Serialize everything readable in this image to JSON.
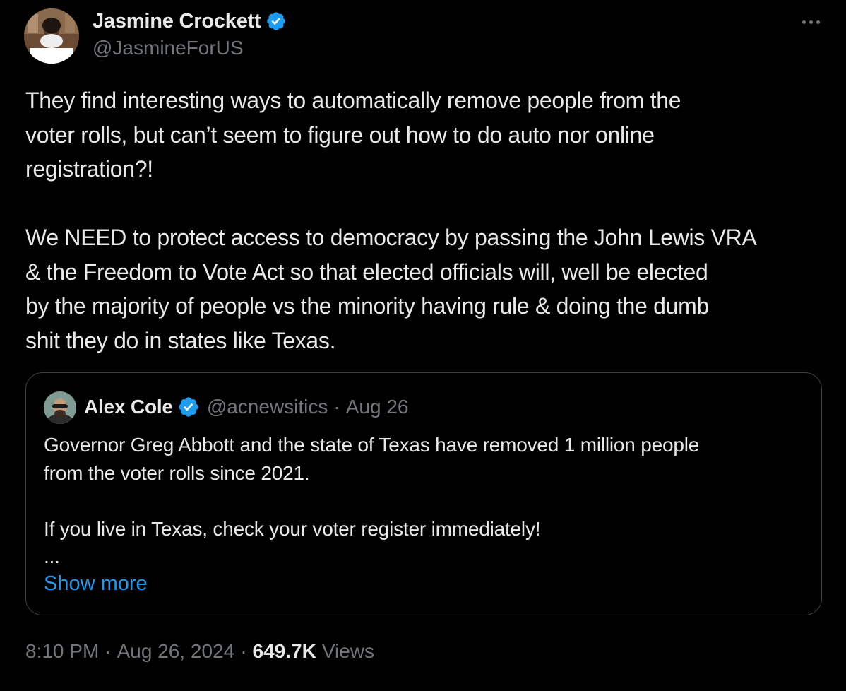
{
  "author": {
    "name": "Jasmine Crockett",
    "handle": "@JasmineForUS",
    "verified": true
  },
  "tweet": {
    "text": "They find interesting ways to automatically remove people from the\nvoter rolls, but can’t seem to figure out how to do auto nor online\nregistration?!\n\nWe NEED to protect access to democracy by passing the John Lewis VRA\n& the Freedom to Vote Act so that elected officials will, well be elected\nby the majority of people vs the minority having rule & doing the dumb\nshit they do in states like Texas."
  },
  "quote": {
    "name": "Alex Cole",
    "handle": "@acnewsitics",
    "separator": "·",
    "date": "Aug 26",
    "text": "Governor Greg Abbott and the state of Texas have removed 1 million people\nfrom the voter rolls since 2021.\n\nIf you live in Texas, check your voter register immediately!\n...",
    "show_more_label": "Show more"
  },
  "meta": {
    "time": "8:10 PM",
    "separator": "·",
    "date": "Aug 26, 2024",
    "views_count": "649.7K",
    "views_label": "Views"
  },
  "icons": {
    "verified": "verified-badge-icon",
    "more": "more-horizontal-icon"
  },
  "colors": {
    "background": "#000000",
    "text_primary": "#e7e9ea",
    "text_secondary": "#71767b",
    "accent": "#1d9bf0",
    "border": "#3e4144"
  }
}
